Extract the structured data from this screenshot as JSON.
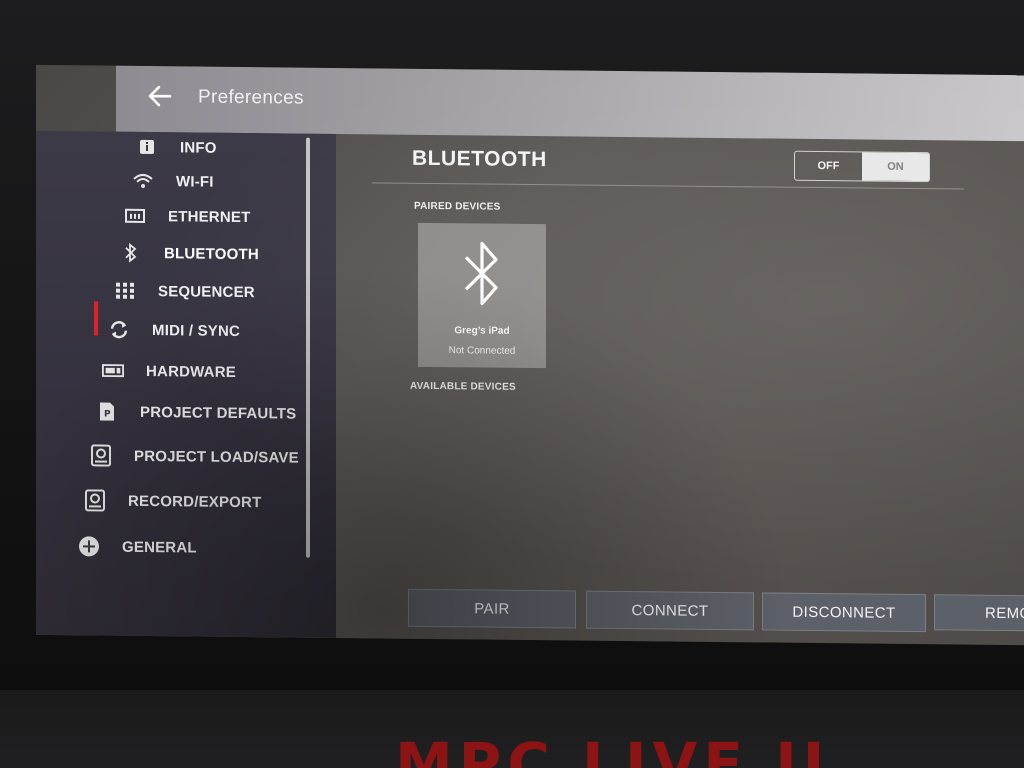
{
  "header": {
    "title": "Preferences"
  },
  "sidebar": {
    "items": [
      {
        "label": "INFO",
        "icon": "info-icon"
      },
      {
        "label": "WI-FI",
        "icon": "wifi-icon"
      },
      {
        "label": "ETHERNET",
        "icon": "ethernet-icon"
      },
      {
        "label": "BLUETOOTH",
        "icon": "bluetooth-icon",
        "active": true
      },
      {
        "label": "SEQUENCER",
        "icon": "grid-icon"
      },
      {
        "label": "MIDI / SYNC",
        "icon": "sync-icon"
      },
      {
        "label": "HARDWARE",
        "icon": "hardware-icon"
      },
      {
        "label": "PROJECT DEFAULTS",
        "icon": "project-file-icon"
      },
      {
        "label": "PROJECT LOAD/SAVE",
        "icon": "disk-icon"
      },
      {
        "label": "RECORD/EXPORT",
        "icon": "record-export-icon"
      },
      {
        "label": "GENERAL",
        "icon": "plus-icon"
      }
    ]
  },
  "main": {
    "title": "BLUETOOTH",
    "toggle": {
      "off_label": "OFF",
      "on_label": "ON",
      "state": "ON"
    },
    "paired_label": "PAIRED DEVICES",
    "available_label": "AVAILABLE DEVICES",
    "paired_devices": [
      {
        "name": "Greg’s iPad",
        "status": "Not Connected"
      }
    ]
  },
  "footer": {
    "buttons": [
      "PAIR",
      "CONNECT",
      "DISCONNECT",
      "REMO"
    ]
  },
  "device": {
    "model_label": "MPC LIVE II"
  },
  "colors": {
    "accent": "#e0202a"
  }
}
